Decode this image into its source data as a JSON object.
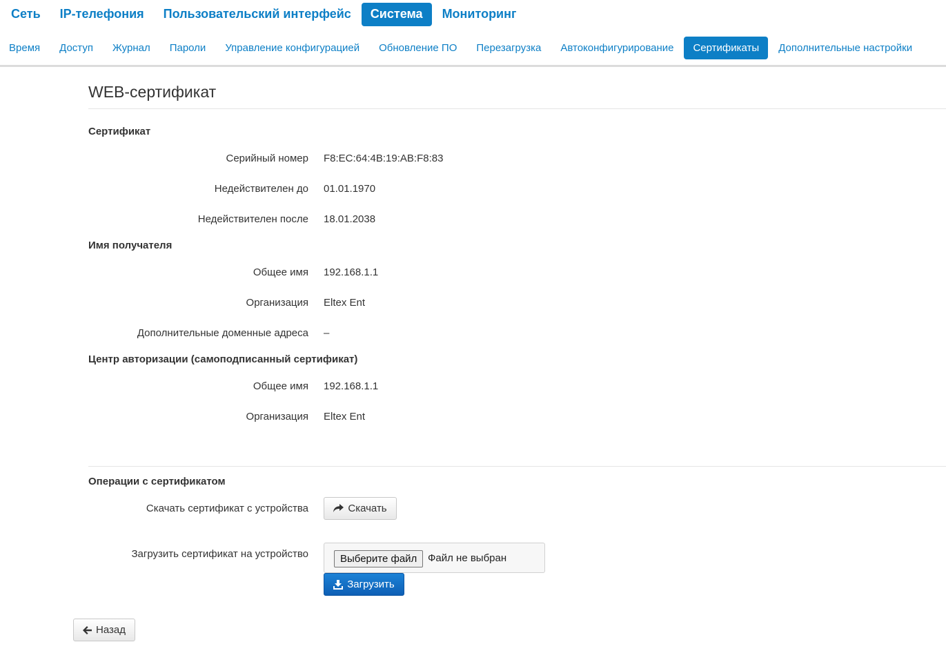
{
  "top_nav": {
    "items": [
      {
        "label": "Сеть"
      },
      {
        "label": "IP-телефония"
      },
      {
        "label": "Пользовательский интерфейс"
      },
      {
        "label": "Система"
      },
      {
        "label": "Мониторинг"
      }
    ],
    "active": "Система"
  },
  "sub_nav": {
    "items": [
      {
        "label": "Время"
      },
      {
        "label": "Доступ"
      },
      {
        "label": "Журнал"
      },
      {
        "label": "Пароли"
      },
      {
        "label": "Управление конфигурацией"
      },
      {
        "label": "Обновление ПО"
      },
      {
        "label": "Перезагрузка"
      },
      {
        "label": "Автоконфигурирование"
      },
      {
        "label": "Сертификаты"
      },
      {
        "label": "Дополнительные настройки"
      }
    ],
    "active": "Сертификаты"
  },
  "page": {
    "title": "WEB-сертификат"
  },
  "certificate": {
    "heading": "Сертификат",
    "serial_label": "Серийный номер",
    "serial_value": "F8:EC:64:4B:19:AB:F8:83",
    "not_before_label": "Недействителен до",
    "not_before_value": "01.01.1970",
    "not_after_label": "Недействителен после",
    "not_after_value": "18.01.2038"
  },
  "subject": {
    "heading": "Имя получателя",
    "cn_label": "Общее имя",
    "cn_value": "192.168.1.1",
    "org_label": "Организация",
    "org_value": "Eltex Ent",
    "san_label": "Дополнительные доменные адреса",
    "san_value": "–"
  },
  "issuer": {
    "heading": "Центр авторизации (самоподписанный сертификат)",
    "cn_label": "Общее имя",
    "cn_value": "192.168.1.1",
    "org_label": "Организация",
    "org_value": "Eltex Ent"
  },
  "operations": {
    "heading": "Операции с сертификатом",
    "download_label": "Скачать сертификат с устройства",
    "download_button": "Скачать",
    "upload_label": "Загрузить сертификат на устройство",
    "choose_file_button": "Выберите файл",
    "file_status": "Файл не выбран",
    "upload_button": "Загрузить"
  },
  "back_button": "Назад",
  "colors": {
    "accent": "#0d7fc6",
    "primary_button": "#1a7bd0",
    "divider": "#dcdcdc"
  },
  "icons": {
    "download": "share-arrow-icon",
    "upload": "download-tray-icon",
    "back": "arrow-left-icon"
  }
}
